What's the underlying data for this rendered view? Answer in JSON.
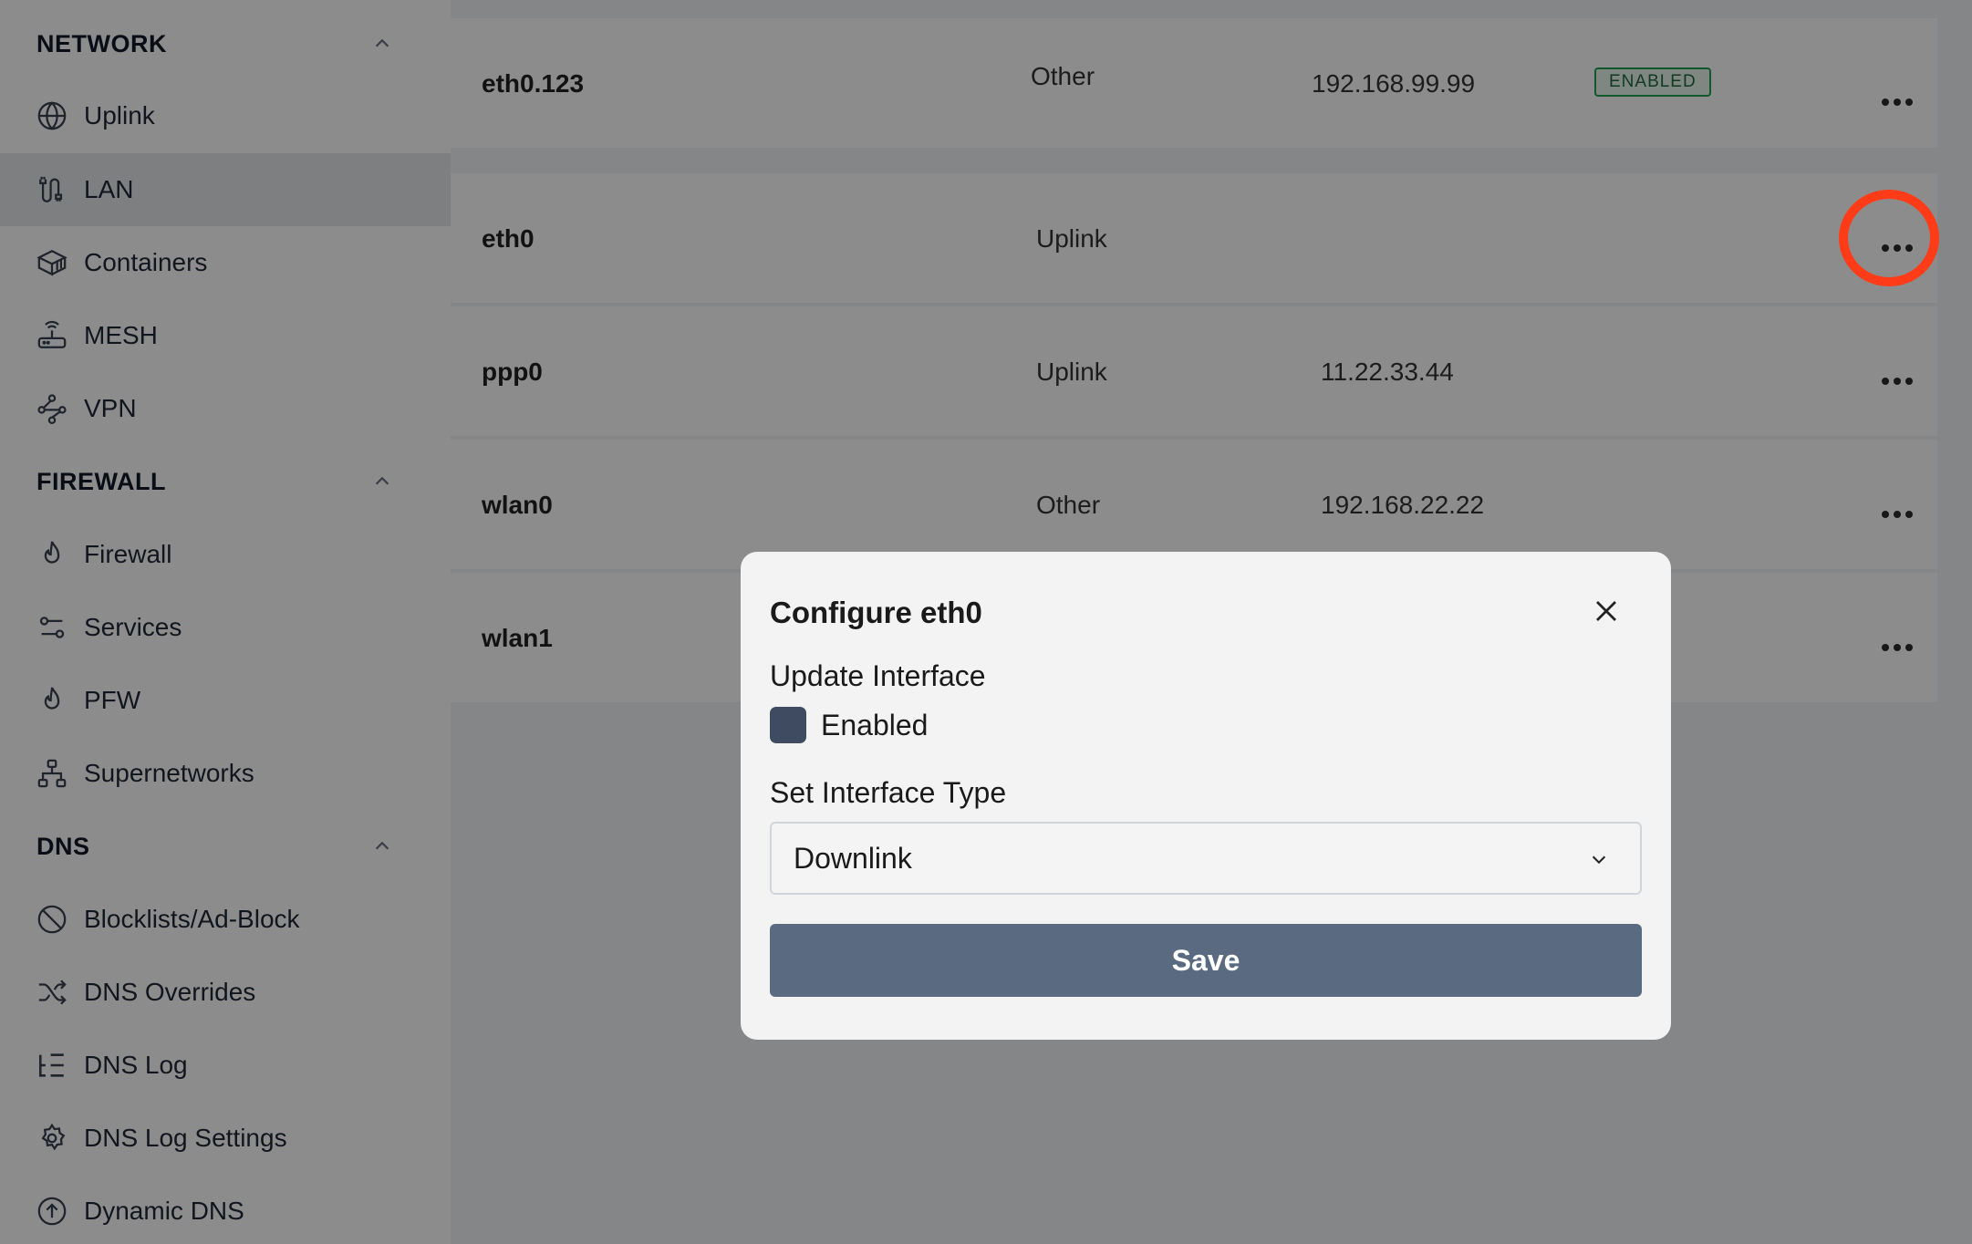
{
  "sidebar": {
    "sections": [
      {
        "title": "NETWORK",
        "items": [
          {
            "label": "Uplink",
            "icon": "globe-icon"
          },
          {
            "label": "LAN",
            "icon": "cable-plug-icon",
            "active": true
          },
          {
            "label": "Containers",
            "icon": "container-box-icon"
          },
          {
            "label": "MESH",
            "icon": "router-wifi-icon"
          },
          {
            "label": "VPN",
            "icon": "network-nodes-icon"
          }
        ]
      },
      {
        "title": "FIREWALL",
        "items": [
          {
            "label": "Firewall",
            "icon": "flame-icon"
          },
          {
            "label": "Services",
            "icon": "sliders-icon"
          },
          {
            "label": "PFW",
            "icon": "flame-icon"
          },
          {
            "label": "Supernetworks",
            "icon": "network-hierarchy-icon"
          }
        ]
      },
      {
        "title": "DNS",
        "items": [
          {
            "label": "Blocklists/Ad-Block",
            "icon": "block-icon"
          },
          {
            "label": "DNS Overrides",
            "icon": "shuffle-icon"
          },
          {
            "label": "DNS Log",
            "icon": "list-tree-icon"
          },
          {
            "label": "DNS Log Settings",
            "icon": "gear-icon"
          },
          {
            "label": "Dynamic DNS",
            "icon": "arrow-up-circle-icon"
          }
        ]
      }
    ]
  },
  "interfaces": [
    {
      "name": "eth0.123",
      "type": "Other",
      "ip": "192.168.99.99",
      "status": "ENABLED"
    },
    {
      "name": "eth0",
      "type": "Uplink",
      "ip": "",
      "status": ""
    },
    {
      "name": "ppp0",
      "type": "Uplink",
      "ip": "11.22.33.44",
      "status": ""
    },
    {
      "name": "wlan0",
      "type": "Other",
      "ip": "192.168.22.22",
      "status": ""
    },
    {
      "name": "wlan1",
      "type": "",
      "ip": "",
      "status": ""
    }
  ],
  "modal": {
    "title": "Configure eth0",
    "update_label": "Update Interface",
    "enabled_label": "Enabled",
    "enabled_checked": true,
    "type_label": "Set Interface Type",
    "type_value": "Downlink",
    "save_label": "Save"
  },
  "colors": {
    "highlight_ring": "#ff3c17",
    "save_button": "#5a6a80",
    "badge_green": "#22a055"
  }
}
